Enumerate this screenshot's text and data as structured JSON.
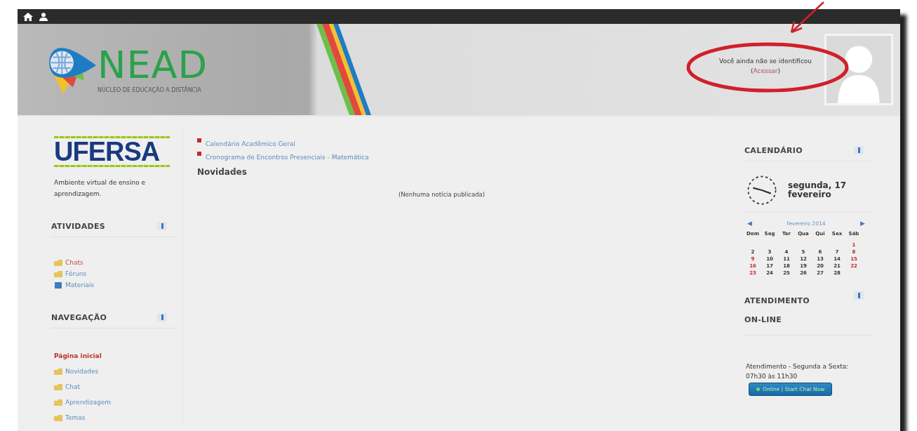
{
  "header": {
    "logo": {
      "text": "NEAD",
      "subtitle": "NÚCLEO DE EDUCAÇÃO A DISTÂNCIA"
    },
    "login": {
      "text": "Você ainda não se identificou (",
      "link": "Acessar",
      "after": ")"
    }
  },
  "left": {
    "brand": "UFERSA",
    "description": "Ambiente virtual de ensino e aprendizagem.",
    "blocks": [
      {
        "title": "ATIVIDADES",
        "items": [
          {
            "label": "Chats",
            "kind": "folder",
            "current": false,
            "visited": true
          },
          {
            "label": "Fóruns",
            "kind": "folder",
            "current": false,
            "visited": false
          },
          {
            "label": "Materiais",
            "kind": "file",
            "current": false,
            "visited": false
          }
        ]
      },
      {
        "title": "NAVEGAÇÃO",
        "items": [
          {
            "label": "Página inicial",
            "kind": "plain",
            "current": true,
            "visited": false
          },
          {
            "label": "Novidades",
            "kind": "folder",
            "current": false,
            "visited": false
          },
          {
            "label": "Chat",
            "kind": "folder",
            "current": false,
            "visited": false
          },
          {
            "label": "Aprendizagem",
            "kind": "folder",
            "current": false,
            "visited": false
          },
          {
            "label": "Temas",
            "kind": "folder",
            "current": false,
            "visited": false
          }
        ]
      }
    ]
  },
  "main": {
    "links": [
      "Calendário Acadêmico Geral",
      "Cronograma de Encontros Presenciais - Matemática"
    ],
    "news_title": "Novidades",
    "news_empty": "(Nenhuma notícia publicada)"
  },
  "right": {
    "calendar": {
      "title": "CALENDÁRIO",
      "today": "segunda, 17 fevereiro",
      "prev": "◀",
      "month": "fevereiro 2014",
      "next": "▶",
      "weekdays": [
        "Dom",
        "Seg",
        "Ter",
        "Qua",
        "Qui",
        "Sex",
        "Sáb"
      ],
      "weeks": [
        [
          {
            "kind": "blank"
          },
          {
            "kind": "blank"
          },
          {
            "kind": "blank"
          },
          {
            "kind": "blank"
          },
          {
            "kind": "blank"
          },
          {
            "kind": "blank"
          },
          {
            "day": "1",
            "weekend": true
          }
        ],
        [
          {
            "day": "2",
            "weekend": false
          },
          {
            "day": "3",
            "weekend": false
          },
          {
            "day": "4",
            "weekend": false
          },
          {
            "day": "5",
            "weekend": false
          },
          {
            "day": "6",
            "weekend": false
          },
          {
            "day": "7",
            "weekend": false
          },
          {
            "day": "8",
            "weekend": true
          }
        ],
        [
          {
            "day": "9",
            "weekend": true
          },
          {
            "day": "10",
            "weekend": false
          },
          {
            "day": "11",
            "weekend": false
          },
          {
            "day": "12",
            "weekend": false
          },
          {
            "day": "13",
            "weekend": false
          },
          {
            "day": "14",
            "weekend": false
          },
          {
            "day": "15",
            "weekend": true
          }
        ],
        [
          {
            "day": "16",
            "weekend": true
          },
          {
            "day": "17",
            "weekend": false
          },
          {
            "day": "18",
            "weekend": false
          },
          {
            "day": "19",
            "weekend": false
          },
          {
            "day": "20",
            "weekend": false
          },
          {
            "day": "21",
            "weekend": false
          },
          {
            "day": "22",
            "weekend": true
          }
        ],
        [
          {
            "day": "23",
            "weekend": true
          },
          {
            "day": "24",
            "weekend": false
          },
          {
            "day": "25",
            "weekend": false
          },
          {
            "day": "26",
            "weekend": false
          },
          {
            "day": "27",
            "weekend": false
          },
          {
            "day": "28",
            "weekend": false
          },
          {
            "kind": "blank"
          }
        ]
      ]
    },
    "support": {
      "title": "ATENDIMENTO ON-LINE",
      "text": "Atendimento - Segunda a Sexta: 07h30 às 11h30",
      "button": "Online | Start Chat Now"
    }
  }
}
